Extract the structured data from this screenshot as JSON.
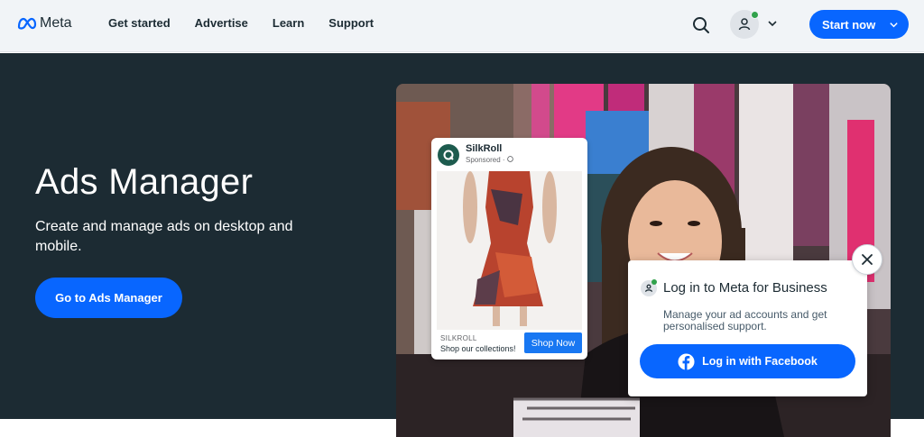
{
  "nav": {
    "logo_text": "Meta",
    "links": [
      "Get started",
      "Advertise",
      "Learn",
      "Support"
    ],
    "start_label": "Start now"
  },
  "hero": {
    "title": "Ads Manager",
    "subtitle": "Create and manage ads on desktop and mobile.",
    "button_label": "Go to Ads Manager"
  },
  "ad": {
    "brand": "SilkRoll",
    "sponsored": "Sponsored · ",
    "footer_name": "SILKROLL",
    "footer_text": "Shop our collections!",
    "cta": "Shop Now"
  },
  "login": {
    "title": "Log in to Meta for Business",
    "description": "Manage your ad accounts and get personalised support.",
    "button_label": "Log in with Facebook"
  },
  "colors": {
    "accent": "#0866ff",
    "hero_bg": "#1c2b33",
    "nav_bg": "#f1f4f7",
    "online": "#31a24c"
  },
  "icons": [
    "meta-logo-icon",
    "search-icon",
    "user-icon",
    "chevron-down-icon",
    "facebook-icon",
    "close-icon",
    "globe-icon"
  ]
}
